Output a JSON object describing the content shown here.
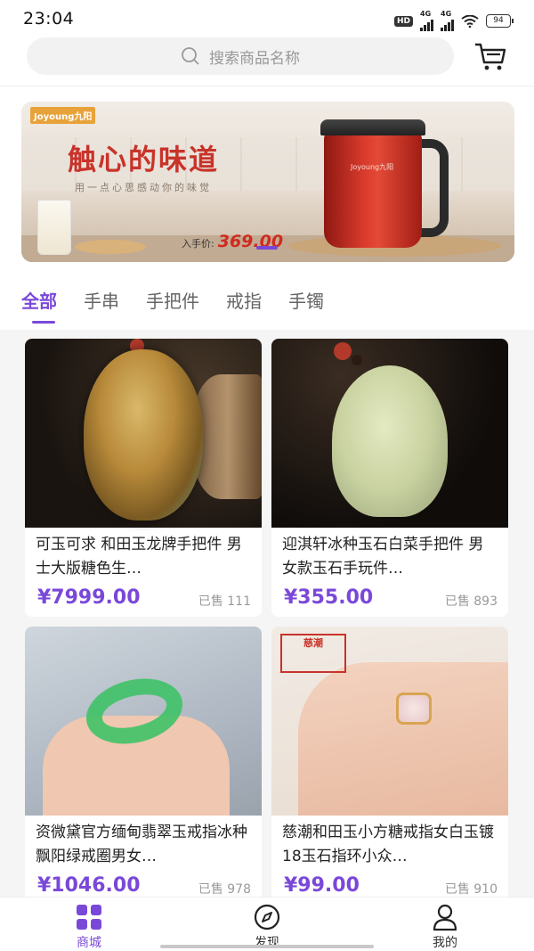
{
  "status_bar": {
    "time": "23:04",
    "hd_label": "HD",
    "net1": "4G",
    "net2": "4G",
    "battery": "94"
  },
  "header": {
    "search_placeholder": "搜索商品名称"
  },
  "banner": {
    "brand": "Joyoung九阳",
    "slogan": "触心的味道",
    "subtitle": "用一点心思感动你的味觉",
    "price_label": "入手价:",
    "price": "369.00",
    "appliance_logo": "Joyoung九阳"
  },
  "tabs": [
    {
      "label": "全部",
      "active": true
    },
    {
      "label": "手串"
    },
    {
      "label": "手把件"
    },
    {
      "label": "戒指"
    },
    {
      "label": "手镯"
    }
  ],
  "products": [
    {
      "title": "可玉可求 和田玉龙牌手把件 男士大版糖色生…",
      "price": "¥7999.00",
      "sold": "已售 111"
    },
    {
      "title": "迎淇轩冰种玉石白菜手把件 男女款玉石手玩件…",
      "price": "¥355.00",
      "sold": "已售 893"
    },
    {
      "title": "资微黛官方缅甸翡翠玉戒指冰种飘阳绿戒圈男女…",
      "price": "¥1046.00",
      "sold": "已售 978"
    },
    {
      "title": "慈潮和田玉小方糖戒指女白玉镀18玉石指环小众…",
      "price": "¥99.00",
      "sold": "已售 910",
      "image_stamp": "慈潮"
    }
  ],
  "bottom_nav": [
    {
      "label": "商城",
      "icon": "grid-icon",
      "active": true
    },
    {
      "label": "发现",
      "icon": "compass-icon"
    },
    {
      "label": "我的",
      "icon": "user-icon"
    }
  ],
  "colors": {
    "accent": "#7a48d8",
    "price": "#7a48d8",
    "banner_red": "#d83a2c"
  }
}
